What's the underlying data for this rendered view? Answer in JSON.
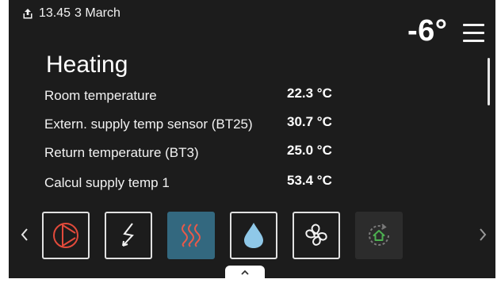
{
  "status": {
    "time": "13.45",
    "date": "3 March",
    "icon": "upload-icon"
  },
  "outdoor_temp": "-6°",
  "menu": {
    "icon": "hamburger-menu-icon"
  },
  "page": {
    "title": "Heating",
    "rows": [
      {
        "label": "Room temperature",
        "value": "22.3 °C"
      },
      {
        "label": "Extern. supply temp sensor (BT25)",
        "value": "30.7 °C"
      },
      {
        "label": "Return temperature (BT3)",
        "value": "25.0 °C"
      },
      {
        "label": "Calcul supply temp 1",
        "value": "53.4 °C"
      }
    ]
  },
  "nav": {
    "prev_icon": "chevron-left-icon",
    "next_icon": "chevron-right-icon",
    "tiles": [
      {
        "icon": "compressor-icon",
        "state": "normal"
      },
      {
        "icon": "electric-heater-icon",
        "state": "normal"
      },
      {
        "icon": "heating-icon",
        "state": "active"
      },
      {
        "icon": "hot-water-icon",
        "state": "normal"
      },
      {
        "icon": "ventilation-fan-icon",
        "state": "normal"
      },
      {
        "icon": "smart-home-icon",
        "state": "dimmed"
      }
    ]
  },
  "bottom_handle": {
    "icon": "chevron-up-icon"
  },
  "colors": {
    "background": "#1c1c1c",
    "active_tile": "#33687f",
    "compressor_red": "#e24a3b",
    "heating_red": "#e85a4a",
    "water_blue": "#8fc8e8",
    "smart_home_green": "#4caf50"
  }
}
